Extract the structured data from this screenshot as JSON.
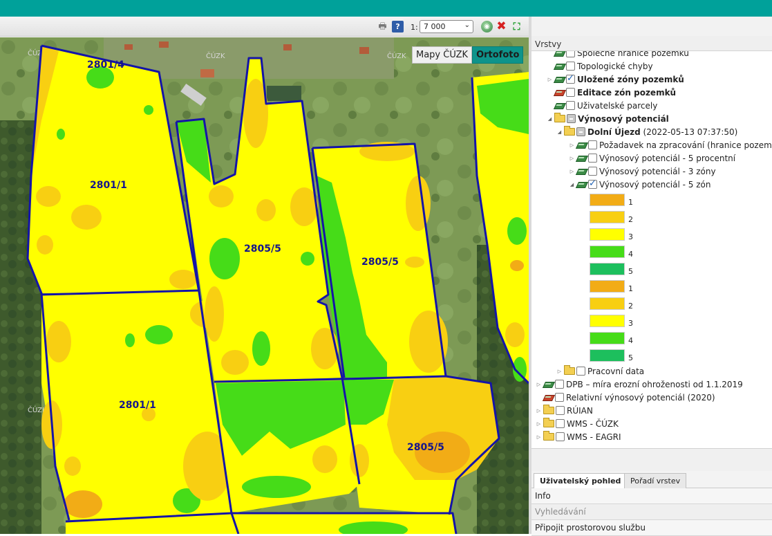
{
  "toolbar": {
    "scale_prefix": "1:",
    "scale_value": "7 000"
  },
  "basemap": {
    "cuzk_label": "Mapy ČÚZK",
    "orto_label": "Ortofoto"
  },
  "map": {
    "watermark": "ČÚZK",
    "parcels": [
      {
        "id": "p1",
        "label": "2801/4"
      },
      {
        "id": "p2",
        "label": "2801/1"
      },
      {
        "id": "p3",
        "label": "2805/5"
      },
      {
        "id": "p4",
        "label": "2805/5"
      },
      {
        "id": "p5",
        "label": "2801/1"
      },
      {
        "id": "p6",
        "label": "2805/5"
      }
    ]
  },
  "panel": {
    "title": "Vrstvy",
    "tree": [
      {
        "label": "Společné hranice pozemků",
        "level": 0,
        "icon": "layer",
        "checked": false,
        "bold": false
      },
      {
        "label": "Topologické chyby",
        "level": 0,
        "icon": "layer",
        "checked": false,
        "bold": false
      },
      {
        "label": "Uložené zóny pozemků",
        "level": 0,
        "icon": "layer",
        "checked": true,
        "bold": true,
        "expander": "▷"
      },
      {
        "label": "Editace zón pozemků",
        "level": 0,
        "icon": "edit",
        "checked": false,
        "bold": true
      },
      {
        "label": "Uživatelské parcely",
        "level": 0,
        "icon": "layer",
        "checked": false,
        "bold": false
      },
      {
        "label": "Výnosový potenciál",
        "level": 0,
        "icon": "folder",
        "checked": "partial",
        "bold": true,
        "expander": "◢"
      },
      {
        "label": "Dolní Újezd",
        "suffix": " (2022-05-13 07:37:50)",
        "level": 1,
        "icon": "folder",
        "checked": "partial",
        "bold": true,
        "expander": "◢"
      },
      {
        "label": "Požadavek na zpracování (hranice pozemků)",
        "level": 2,
        "icon": "layer",
        "checked": false,
        "bold": false,
        "expander": "▷"
      },
      {
        "label": "Výnosový potenciál - 5 procentní",
        "level": 2,
        "icon": "layer",
        "checked": false,
        "bold": false,
        "expander": "▷"
      },
      {
        "label": "Výnosový potenciál - 3 zóny",
        "level": 2,
        "icon": "layer",
        "checked": false,
        "bold": false,
        "expander": "▷"
      },
      {
        "label": "Výnosový potenciál - 5 zón",
        "level": 2,
        "icon": "layer",
        "checked": true,
        "bold": false,
        "expander": "◢"
      }
    ],
    "legend": [
      {
        "label": "1",
        "color": "#f2ac16"
      },
      {
        "label": "2",
        "color": "#f8cf12"
      },
      {
        "label": "3",
        "color": "#ffff00"
      },
      {
        "label": "4",
        "color": "#46dc18"
      },
      {
        "label": "5",
        "color": "#1dbf5d"
      },
      {
        "label": "1",
        "color": "#f2ac16"
      },
      {
        "label": "2",
        "color": "#f8cf12"
      },
      {
        "label": "3",
        "color": "#ffff00"
      },
      {
        "label": "4",
        "color": "#46dc18"
      },
      {
        "label": "5",
        "color": "#1dbf5d"
      }
    ],
    "tree_after": [
      {
        "label": "Pracovní data",
        "level": 1,
        "icon": "folder",
        "checked": false,
        "bold": false,
        "expander": "▷"
      },
      {
        "label": "DPB – míra erozní ohroženosti od 1.1.2019",
        "level": -1,
        "icon": "layer",
        "checked": false,
        "bold": false,
        "expander": "▷"
      },
      {
        "label": "Relativní výnosový potenciál (2020)",
        "level": -1,
        "icon": "edit",
        "checked": false,
        "bold": false,
        "expander": ""
      },
      {
        "label": "RÚIAN",
        "level": -1,
        "icon": "folder",
        "checked": false,
        "bold": false,
        "expander": "▷"
      },
      {
        "label": "WMS - ČÚZK",
        "level": -1,
        "icon": "folder",
        "checked": false,
        "bold": false,
        "expander": "▷"
      },
      {
        "label": "WMS - EAGRI",
        "level": -1,
        "icon": "folder",
        "checked": false,
        "bold": false,
        "expander": "▷"
      }
    ],
    "tabs": {
      "user_view": "Uživatelský pohled",
      "layer_order": "Pořadí vrstev"
    },
    "accordion": {
      "info": "Info",
      "search": "Vyhledávání",
      "connect": "Připojit prostorovou službu"
    }
  },
  "colors": {
    "header": "#00a19a",
    "parcel_border": "#1414a8"
  }
}
